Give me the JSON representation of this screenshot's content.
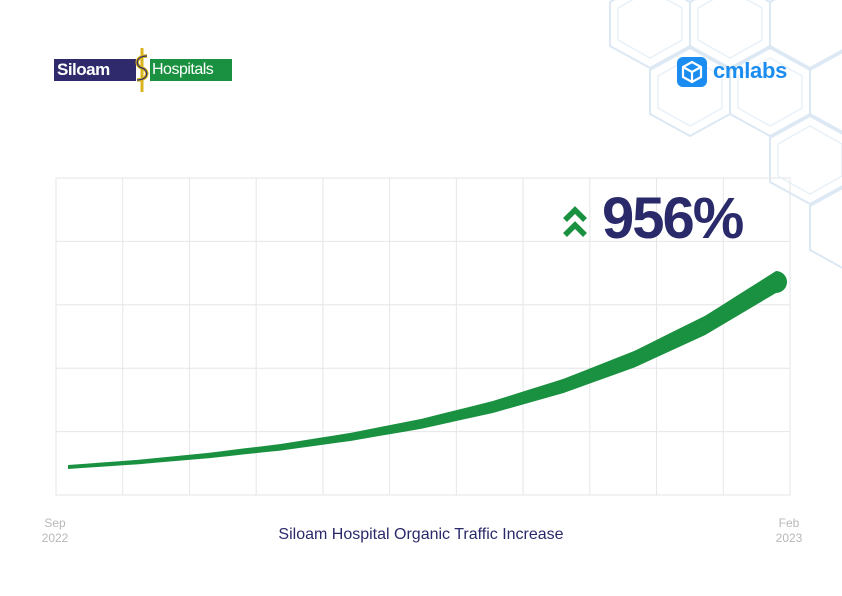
{
  "logos": {
    "siloam": {
      "left_text": "Siloam",
      "right_text": "Hospitals"
    },
    "cmlabs": {
      "text": "cmlabs"
    }
  },
  "colors": {
    "navy": "#2a2a6b",
    "green": "#1a9140",
    "blue": "#1b8df0",
    "grid": "#e6e6ea",
    "decor": "#dce8f3",
    "tick": "#b8b8b8"
  },
  "icons": {
    "growth": "double-chevron-up-icon",
    "cmlabs": "cube-icon"
  },
  "chart_data": {
    "type": "area",
    "title": "",
    "caption": "Siloam Hospital Organic Traffic Increase",
    "highlight": "956%",
    "x_start_label": "Sep 2022",
    "x_end_label": "Feb 2023",
    "x_tick_labels": [
      {
        "month": "Sep",
        "year": "2022"
      },
      {
        "month": "Feb",
        "year": "2023"
      }
    ],
    "x": [
      0,
      0.1,
      0.2,
      0.3,
      0.4,
      0.5,
      0.6,
      0.7,
      0.8,
      0.9,
      1.0
    ],
    "values": [
      1.0,
      1.26,
      1.6,
      2.02,
      2.56,
      3.24,
      4.1,
      5.19,
      6.57,
      8.32,
      10.56
    ],
    "ylim": [
      0,
      12
    ],
    "grid": true,
    "legend": "none"
  }
}
